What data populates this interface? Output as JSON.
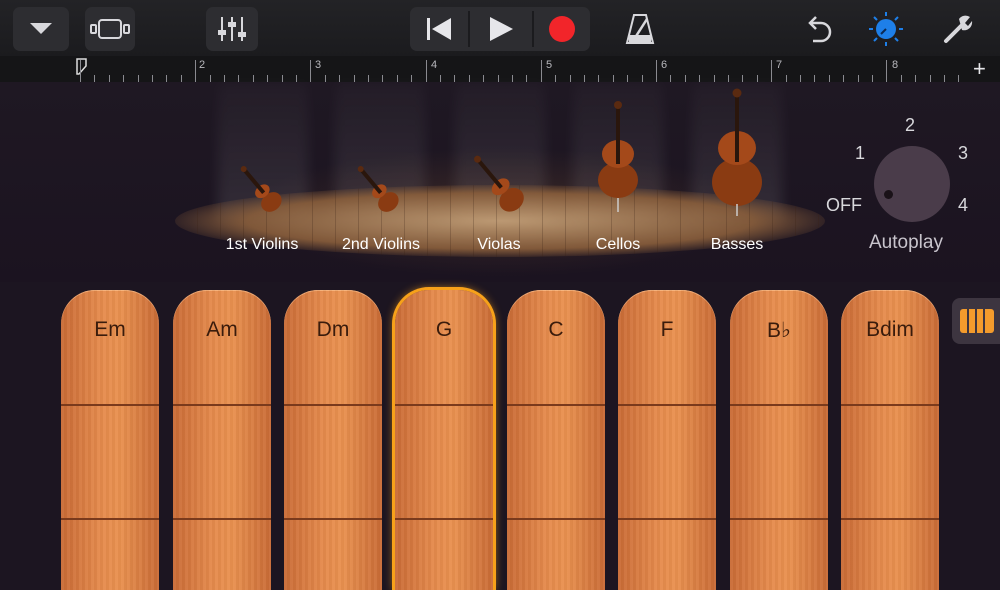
{
  "toolbar": {
    "buttons": [
      {
        "name": "browser-dropdown-button",
        "icon": "chevron-down-icon"
      },
      {
        "name": "tracks-view-button",
        "icon": "tracks-view-icon"
      },
      {
        "name": "mixer-button",
        "icon": "mixer-sliders-icon"
      },
      {
        "name": "go-to-beginning-button",
        "icon": "skip-back-icon"
      },
      {
        "name": "play-button",
        "icon": "play-icon"
      },
      {
        "name": "record-button",
        "icon": "record-icon"
      },
      {
        "name": "metronome-button",
        "icon": "metronome-icon"
      },
      {
        "name": "undo-button",
        "icon": "undo-icon"
      },
      {
        "name": "master-effects-button",
        "icon": "knob-icon"
      },
      {
        "name": "settings-button",
        "icon": "wrench-icon"
      }
    ],
    "colors": {
      "record": "#f2252a",
      "knob_accent": "#1e7fe8"
    }
  },
  "ruler": {
    "bars": [
      "2",
      "3",
      "4",
      "5",
      "6",
      "7",
      "8"
    ],
    "add_label": "+"
  },
  "instruments": [
    {
      "label": "1st Violins"
    },
    {
      "label": "2nd Violins"
    },
    {
      "label": "Violas"
    },
    {
      "label": "Cellos"
    },
    {
      "label": "Basses"
    }
  ],
  "autoplay": {
    "label": "Autoplay",
    "positions": [
      "OFF",
      "1",
      "2",
      "3",
      "4"
    ],
    "selected": "OFF"
  },
  "chords": [
    {
      "label": "Em",
      "active": false
    },
    {
      "label": "Am",
      "active": false
    },
    {
      "label": "Dm",
      "active": false
    },
    {
      "label": "G",
      "active": true
    },
    {
      "label": "C",
      "active": false
    },
    {
      "label": "F",
      "active": false
    },
    {
      "label": "B♭",
      "active": false
    },
    {
      "label": "Bdim",
      "active": false
    }
  ],
  "colors": {
    "accent_orange": "#f39b2c",
    "strip_wood": "#e58a4c",
    "background": "#1c1521"
  }
}
